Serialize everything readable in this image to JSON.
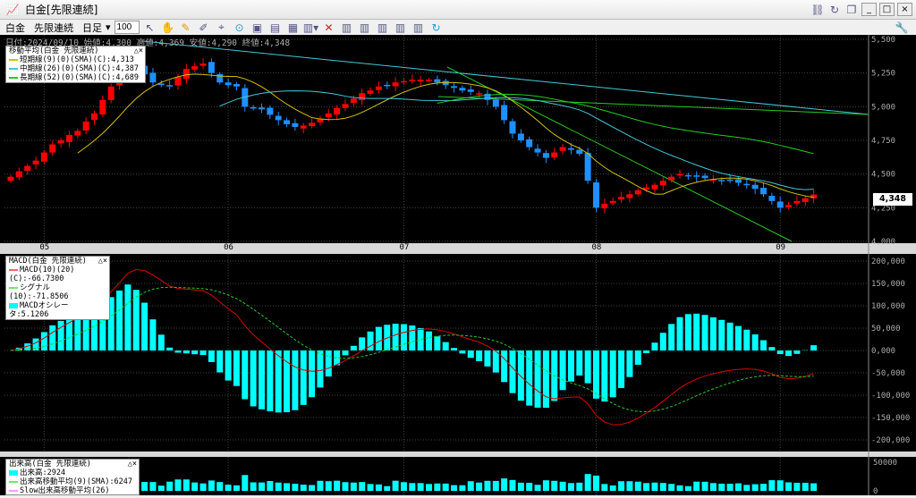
{
  "window": {
    "title": "白金[先限連続]",
    "controls": [
      "_",
      "□",
      "×"
    ]
  },
  "toolbar": {
    "item1": "白金",
    "item2": "先限連続",
    "period": "日足",
    "count": "100"
  },
  "info": {
    "text": "日付:2024/09/10 始値:4,300 高値:4,369 安値:4,290 終値:4,348",
    "last_price": "4,348"
  },
  "ma_legend": {
    "title": "移動平均(白金 先限連続)",
    "lines": [
      "短期線(9)(0)(SMA)(C):4,313",
      "中期線(26)(0)(SMA)(C):4,387",
      "長期線(52)(0)(SMA)(C):4,689"
    ]
  },
  "macd_legend": {
    "title": "MACD(白金 先限連続)",
    "lines": [
      "MACD(10)(20)(C):-66.7300",
      "シグナル(10):-71.8506",
      "MACDオシレータ:5.1206"
    ]
  },
  "vol_legend": {
    "title": "出来高(白金 先限連続)",
    "lines": [
      "出来高:2924",
      "出来高移動平均(9)(SMA):6247",
      "Slow出来高移動平均(26)(SMA):7979"
    ]
  },
  "colors": {
    "up": "#ff0000",
    "down": "#1e90ff",
    "short": "#d4c000",
    "mid": "#40c8d8",
    "long": "#22cc22",
    "osc": "#00ffff"
  },
  "chart_data": {
    "type": "candlestick",
    "price_axis": [
      "5,500",
      "5,250",
      "5,000",
      "4,750",
      "4,500",
      "4,250",
      "4,000"
    ],
    "price_range": [
      4000,
      5500
    ],
    "macd_axis": [
      "200,000",
      "150,000",
      "100,000",
      "50,000",
      "0,000",
      "-50,000",
      "-100,000",
      "-150,000",
      "-200,000"
    ],
    "vol_axis": [
      "50000",
      "0"
    ],
    "month_labels": [
      {
        "label": "05",
        "bar": 4
      },
      {
        "label": "06",
        "bar": 26
      },
      {
        "label": "07",
        "bar": 47
      },
      {
        "label": "08",
        "bar": 70
      },
      {
        "label": "09",
        "bar": 92
      }
    ],
    "closes": [
      4480,
      4520,
      4560,
      4600,
      4660,
      4720,
      4750,
      4790,
      4820,
      4890,
      4950,
      5050,
      5150,
      5250,
      5350,
      5300,
      5240,
      5180,
      5160,
      5150,
      5220,
      5280,
      5300,
      5320,
      5250,
      5180,
      5160,
      5150,
      5000,
      4990,
      4980,
      4940,
      4900,
      4870,
      4850,
      4860,
      4880,
      4910,
      4950,
      4990,
      5020,
      5060,
      5100,
      5120,
      5150,
      5160,
      5180,
      5190,
      5200,
      5200,
      5200,
      5180,
      5160,
      5140,
      5120,
      5110,
      5100,
      5050,
      5000,
      4900,
      4800,
      4750,
      4700,
      4660,
      4620,
      4660,
      4700,
      4680,
      4650,
      4450,
      4250,
      4280,
      4300,
      4330,
      4350,
      4380,
      4400,
      4420,
      4450,
      4480,
      4500,
      4490,
      4480,
      4470,
      4460,
      4455,
      4450,
      4435,
      4420,
      4390,
      4350,
      4300,
      4250,
      4270,
      4300,
      4320,
      4348
    ]
  }
}
